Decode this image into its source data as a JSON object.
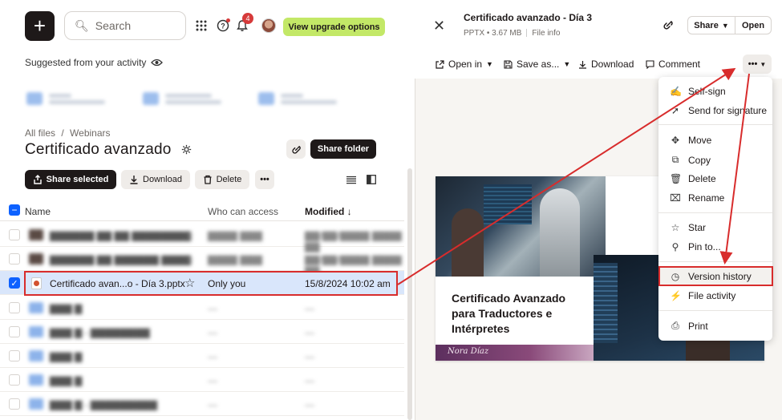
{
  "topbar": {
    "create_symbol": "+",
    "search_placeholder": "Search",
    "notification_count": "4",
    "upgrade_label": "View upgrade options"
  },
  "suggested": {
    "label": "Suggested from your activity"
  },
  "breadcrumb": {
    "root": "All files",
    "sep": "/",
    "current": "Webinars"
  },
  "folder": {
    "title": "Certificado avanzado",
    "share_folder_label": "Share folder"
  },
  "toolbar": {
    "share_selected": "Share selected",
    "download": "Download",
    "delete": "Delete",
    "more": "•••"
  },
  "table": {
    "col_name": "Name",
    "col_access": "Who can access",
    "col_modified": "Modified ↓",
    "selected_row": {
      "name": "Certificado avan...o - Día 3.pptx",
      "access": "Only you",
      "modified": "15/8/2024 10:02 am"
    }
  },
  "preview": {
    "file_title": "Certificado avanzado - Día 3",
    "file_size": "PPTX • 3.67 MB",
    "file_info": "File info",
    "share_label": "Share",
    "open_label": "Open",
    "open_in": "Open in",
    "save_as": "Save as...",
    "download": "Download",
    "comment": "Comment",
    "slide_title": "Certificado Avanzado para Traductores e Intérpretes",
    "slide_signature": "Nora Díaz"
  },
  "menu": {
    "items": {
      "self_sign": "Self-sign",
      "send_signature": "Send for signature",
      "move": "Move",
      "copy": "Copy",
      "delete": "Delete",
      "rename": "Rename",
      "star": "Star",
      "pin": "Pin to...",
      "version_history": "Version history",
      "file_activity": "File activity",
      "print": "Print"
    }
  },
  "colors": {
    "accent_blue": "#0d61ff",
    "annotation_red": "#d82c2c",
    "upgrade_green": "#c3e867"
  }
}
